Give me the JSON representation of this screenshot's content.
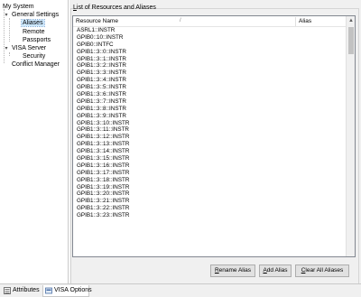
{
  "tree": {
    "items": [
      {
        "label": "My System"
      },
      {
        "label": "General Settings"
      },
      {
        "label": "Aliases"
      },
      {
        "label": "Remote"
      },
      {
        "label": "Passports"
      },
      {
        "label": "VISA Server"
      },
      {
        "label": "Security"
      },
      {
        "label": "Conflict Manager"
      }
    ]
  },
  "panel": {
    "group_title_underlined": "L",
    "group_title_rest": "ist of Resources and Aliases",
    "columns": {
      "resource_name": "Resource Name",
      "alias": "Alias"
    },
    "rows": [
      "ASRL1::INSTR",
      "GPIB0::10::INSTR",
      "GPIB0::INTFC",
      "GPIB1::3::0::INSTR",
      "GPIB1::3::1::INSTR",
      "GPIB1::3::2::INSTR",
      "GPIB1::3::3::INSTR",
      "GPIB1::3::4::INSTR",
      "GPIB1::3::5::INSTR",
      "GPIB1::3::6::INSTR",
      "GPIB1::3::7::INSTR",
      "GPIB1::3::8::INSTR",
      "GPIB1::3::9::INSTR",
      "GPIB1::3::10::INSTR",
      "GPIB1::3::11::INSTR",
      "GPIB1::3::12::INSTR",
      "GPIB1::3::13::INSTR",
      "GPIB1::3::14::INSTR",
      "GPIB1::3::15::INSTR",
      "GPIB1::3::16::INSTR",
      "GPIB1::3::17::INSTR",
      "GPIB1::3::18::INSTR",
      "GPIB1::3::19::INSTR",
      "GPIB1::3::20::INSTR",
      "GPIB1::3::21::INSTR",
      "GPIB1::3::22::INSTR",
      "GPIB1::3::23::INSTR"
    ],
    "buttons": {
      "rename_alias": {
        "pre": "",
        "ul": "R",
        "post": "ename Alias"
      },
      "add_alias": {
        "pre": "",
        "ul": "A",
        "post": "dd Alias"
      },
      "clear_all": {
        "pre": "",
        "ul": "C",
        "post": "lear All Aliases"
      }
    }
  },
  "tabs": [
    {
      "label": "Attributes"
    },
    {
      "label": "VISA Options"
    }
  ],
  "colors": {
    "selection": "#cce8ff",
    "panel_bg": "#f0f0f0"
  }
}
